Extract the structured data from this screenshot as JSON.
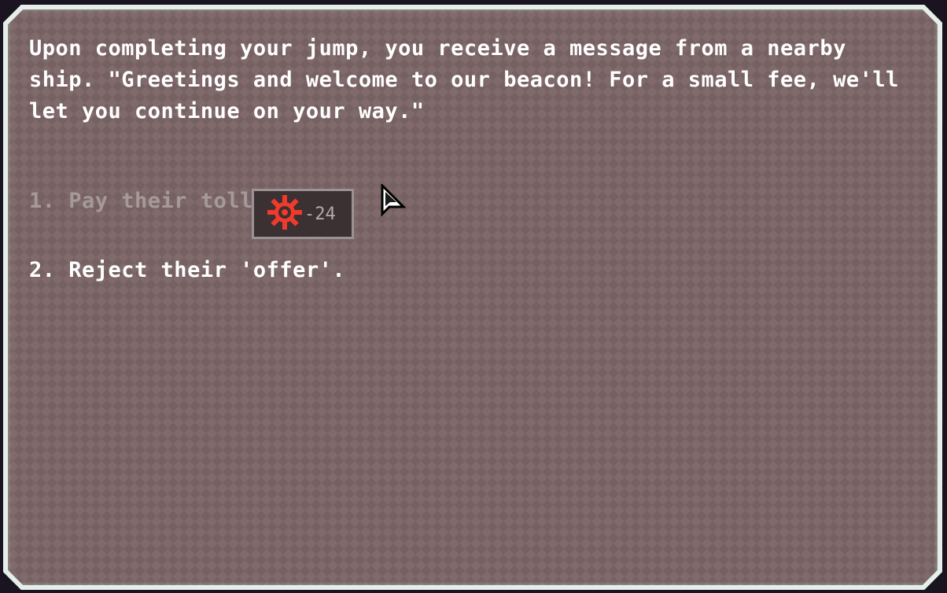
{
  "event": {
    "message": "Upon completing your jump, you receive a message from a nearby ship. \"Greetings and welcome to our beacon! For a small fee, we'll let you continue on your way.\""
  },
  "choices": [
    {
      "label": "1. Pay their toll.",
      "enabled": false,
      "cost": {
        "icon": "scrap-gear-icon",
        "value": "-24"
      }
    },
    {
      "label": "2. Reject their 'offer'.",
      "enabled": true
    }
  ],
  "colors": {
    "panel_bg": "#7b6566",
    "panel_border": "#e4ece8",
    "text_enabled": "#ffffff",
    "text_disabled": "#a6999a",
    "scrap_icon": "#f03a2c"
  }
}
